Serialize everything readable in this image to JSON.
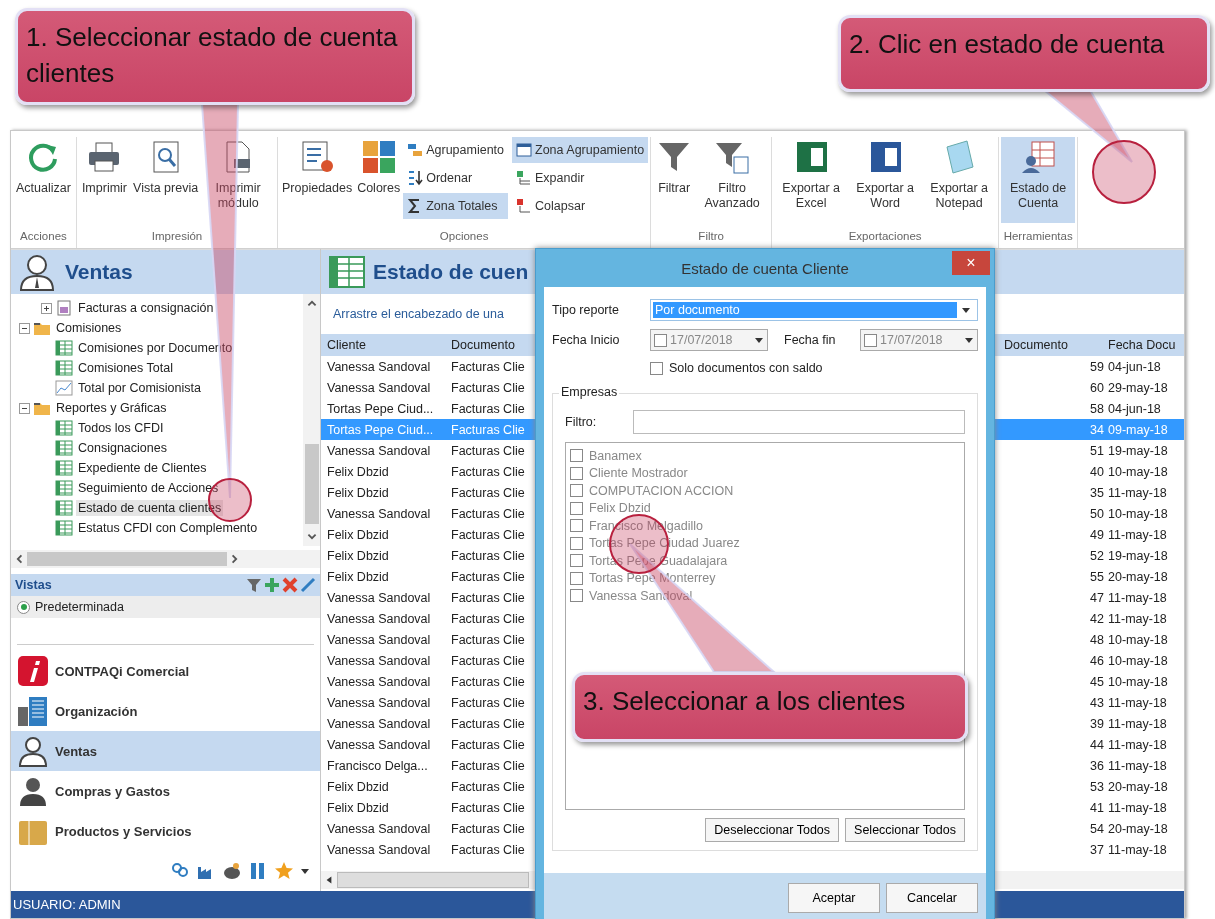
{
  "callouts": [
    {
      "text": "1. Seleccionar estado de cuenta clientes"
    },
    {
      "text": "2. Clic en estado de cuenta"
    },
    {
      "text": "3. Seleccionar a los clientes"
    }
  ],
  "ribbon": {
    "groups": [
      {
        "label": "Acciones",
        "buttons": [
          {
            "label": "Actualizar",
            "selected": false
          }
        ]
      },
      {
        "label": "Impresión",
        "buttons": [
          {
            "label": "Imprimir",
            "selected": false
          },
          {
            "label": "Vista previa",
            "selected": false
          },
          {
            "label": "Imprimir módulo",
            "selected": false
          }
        ]
      },
      {
        "label": "Opciones",
        "buttons": [
          {
            "label": "Propiedades",
            "selected": false
          },
          {
            "label": "Colores",
            "selected": false
          }
        ],
        "small_buttons": [
          {
            "label": "Agrupamiento",
            "selected": false
          },
          {
            "label": "Ordenar",
            "selected": false
          },
          {
            "label": "Zona Totales",
            "selected": true
          },
          {
            "label": "Zona Agrupamiento",
            "selected": true
          },
          {
            "label": "Expandir",
            "selected": false
          },
          {
            "label": "Colapsar",
            "selected": false
          }
        ]
      },
      {
        "label": "Filtro",
        "buttons": [
          {
            "label": "Filtrar",
            "selected": false
          },
          {
            "label": "Filtro Avanzado",
            "selected": false
          }
        ]
      },
      {
        "label": "Exportaciones",
        "buttons": [
          {
            "label": "Exportar a Excel",
            "selected": false
          },
          {
            "label": "Exportar a Word",
            "selected": false
          },
          {
            "label": "Exportar a Notepad",
            "selected": false
          }
        ]
      },
      {
        "label": "Herramientas",
        "buttons": [
          {
            "label": "Estado de Cuenta",
            "selected": true
          }
        ]
      }
    ]
  },
  "sidebar": {
    "title": "Ventas",
    "tree": [
      {
        "label": "Facturas a consignación",
        "kind": "document",
        "expanded": false,
        "selected": false
      },
      {
        "label": "Comisiones",
        "kind": "folder",
        "expanded": true,
        "selected": false,
        "children": [
          {
            "label": "Comisiones por Documento",
            "kind": "grid",
            "selected": false
          },
          {
            "label": "Comisiones Total",
            "kind": "grid",
            "selected": false
          },
          {
            "label": "Total por Comisionista",
            "kind": "chart",
            "selected": false
          }
        ]
      },
      {
        "label": "Reportes y Gráficas",
        "kind": "folder",
        "expanded": true,
        "selected": false,
        "children": [
          {
            "label": "Todos los CFDI",
            "kind": "grid",
            "selected": false
          },
          {
            "label": "Consignaciones",
            "kind": "grid",
            "selected": false
          },
          {
            "label": "Expediente de Clientes",
            "kind": "grid",
            "selected": false
          },
          {
            "label": "Seguimiento de Acciones",
            "kind": "grid",
            "selected": false
          },
          {
            "label": "Estado de cuenta clientes",
            "kind": "grid",
            "selected": true
          },
          {
            "label": "Estatus CFDI con Complemento",
            "kind": "grid",
            "selected": false
          }
        ]
      }
    ],
    "views_title": "Vistas",
    "views": [
      {
        "label": "Predeterminada",
        "selected": true
      }
    ],
    "modules": [
      {
        "label": "CONTPAQi Comercial",
        "selected": false
      },
      {
        "label": "Organización",
        "selected": false
      },
      {
        "label": "Ventas",
        "selected": true
      },
      {
        "label": "Compras y Gastos",
        "selected": false
      },
      {
        "label": "Productos y Servicios",
        "selected": false
      }
    ]
  },
  "grid": {
    "title": "Estado de cuen",
    "group_hint": "Arrastre el encabezado de una",
    "columns": [
      "Cliente",
      "Documento",
      "Documento",
      "Fecha Docu"
    ],
    "rows": [
      {
        "cliente": "Vanessa Sandoval",
        "documento": "Facturas Clie",
        "column_3": "59",
        "fecha": "04-jun-18",
        "selected": false
      },
      {
        "cliente": "Vanessa Sandoval",
        "documento": "Facturas Clie",
        "column_3": "60",
        "fecha": "29-may-18",
        "selected": false
      },
      {
        "cliente": "Tortas Pepe Ciud...",
        "documento": "Facturas Clie",
        "column_3": "58",
        "fecha": "04-jun-18",
        "selected": false
      },
      {
        "cliente": "Tortas Pepe Ciud...",
        "documento": "Facturas Clie",
        "column_3": "34",
        "fecha": "09-may-18",
        "selected": true
      },
      {
        "cliente": "Vanessa Sandoval",
        "documento": "Facturas Clie",
        "column_3": "51",
        "fecha": "19-may-18",
        "selected": false
      },
      {
        "cliente": "Felix Dbzid",
        "documento": "Facturas Clie",
        "column_3": "40",
        "fecha": "10-may-18",
        "selected": false
      },
      {
        "cliente": "Felix Dbzid",
        "documento": "Facturas Clie",
        "column_3": "35",
        "fecha": "11-may-18",
        "selected": false
      },
      {
        "cliente": "Vanessa Sandoval",
        "documento": "Facturas Clie",
        "column_3": "50",
        "fecha": "10-may-18",
        "selected": false
      },
      {
        "cliente": "Felix Dbzid",
        "documento": "Facturas Clie",
        "column_3": "49",
        "fecha": "11-may-18",
        "selected": false
      },
      {
        "cliente": "Felix Dbzid",
        "documento": "Facturas Clie",
        "column_3": "52",
        "fecha": "19-may-18",
        "selected": false
      },
      {
        "cliente": "Felix Dbzid",
        "documento": "Facturas Clie",
        "column_3": "55",
        "fecha": "20-may-18",
        "selected": false
      },
      {
        "cliente": "Vanessa Sandoval",
        "documento": "Facturas Clie",
        "column_3": "47",
        "fecha": "11-may-18",
        "selected": false
      },
      {
        "cliente": "Vanessa Sandoval",
        "documento": "Facturas Clie",
        "column_3": "42",
        "fecha": "11-may-18",
        "selected": false
      },
      {
        "cliente": "Vanessa Sandoval",
        "documento": "Facturas Clie",
        "column_3": "48",
        "fecha": "10-may-18",
        "selected": false
      },
      {
        "cliente": "Vanessa Sandoval",
        "documento": "Facturas Clie",
        "column_3": "46",
        "fecha": "10-may-18",
        "selected": false
      },
      {
        "cliente": "Vanessa Sandoval",
        "documento": "Facturas Clie",
        "column_3": "45",
        "fecha": "10-may-18",
        "selected": false
      },
      {
        "cliente": "Vanessa Sandoval",
        "documento": "Facturas Clie",
        "column_3": "43",
        "fecha": "11-may-18",
        "selected": false
      },
      {
        "cliente": "Vanessa Sandoval",
        "documento": "Facturas Clie",
        "column_3": "39",
        "fecha": "11-may-18",
        "selected": false
      },
      {
        "cliente": "Vanessa Sandoval",
        "documento": "Facturas Clie",
        "column_3": "44",
        "fecha": "11-may-18",
        "selected": false
      },
      {
        "cliente": "Francisco Delga...",
        "documento": "Facturas Clie",
        "column_3": "36",
        "fecha": "11-may-18",
        "selected": false
      },
      {
        "cliente": "Felix Dbzid",
        "documento": "Facturas Clie",
        "column_3": "53",
        "fecha": "20-may-18",
        "selected": false
      },
      {
        "cliente": "Felix Dbzid",
        "documento": "Facturas Clie",
        "column_3": "41",
        "fecha": "11-may-18",
        "selected": false
      },
      {
        "cliente": "Vanessa Sandoval",
        "documento": "Facturas Clie",
        "column_3": "54",
        "fecha": "20-may-18",
        "selected": false
      },
      {
        "cliente": "Vanessa Sandoval",
        "documento": "Facturas Clie",
        "column_3": "37",
        "fecha": "11-may-18",
        "selected": false
      }
    ]
  },
  "status_bar": {
    "text": "USUARIO: ADMIN"
  },
  "dialog": {
    "title": "Estado de cuenta Cliente",
    "close": "×",
    "tipo_label": "Tipo reporte",
    "tipo_value": "Por documento",
    "inicio_label": "Fecha Inicio",
    "inicio_value": "17/07/2018",
    "inicio_checked": false,
    "fin_label": "Fecha fin",
    "fin_value": "17/07/2018",
    "fin_checked": false,
    "solo": {
      "label": "Solo documentos con saldo",
      "checked": false
    },
    "group_title": "Empresas",
    "filter_label": "Filtro:",
    "empresas": [
      {
        "label": "Banamex",
        "checked": false
      },
      {
        "label": "Cliente Mostrador",
        "checked": false
      },
      {
        "label": "COMPUTACION ACCION",
        "checked": false
      },
      {
        "label": "Felix Dbzid",
        "checked": false
      },
      {
        "label": "Francisco Melgadillo",
        "checked": false
      },
      {
        "label": "Tortas Pepe Ciudad Juarez",
        "checked": false
      },
      {
        "label": "Tortas Pepe Guadalajara",
        "checked": false
      },
      {
        "label": "Tortas Pepe Monterrey",
        "checked": false
      },
      {
        "label": "Vanessa Sandoval",
        "checked": false
      }
    ],
    "list_buttons": [
      "Deseleccionar Todos",
      "Seleccionar Todos"
    ],
    "footer_buttons": [
      "Aceptar",
      "Cancelar"
    ]
  }
}
